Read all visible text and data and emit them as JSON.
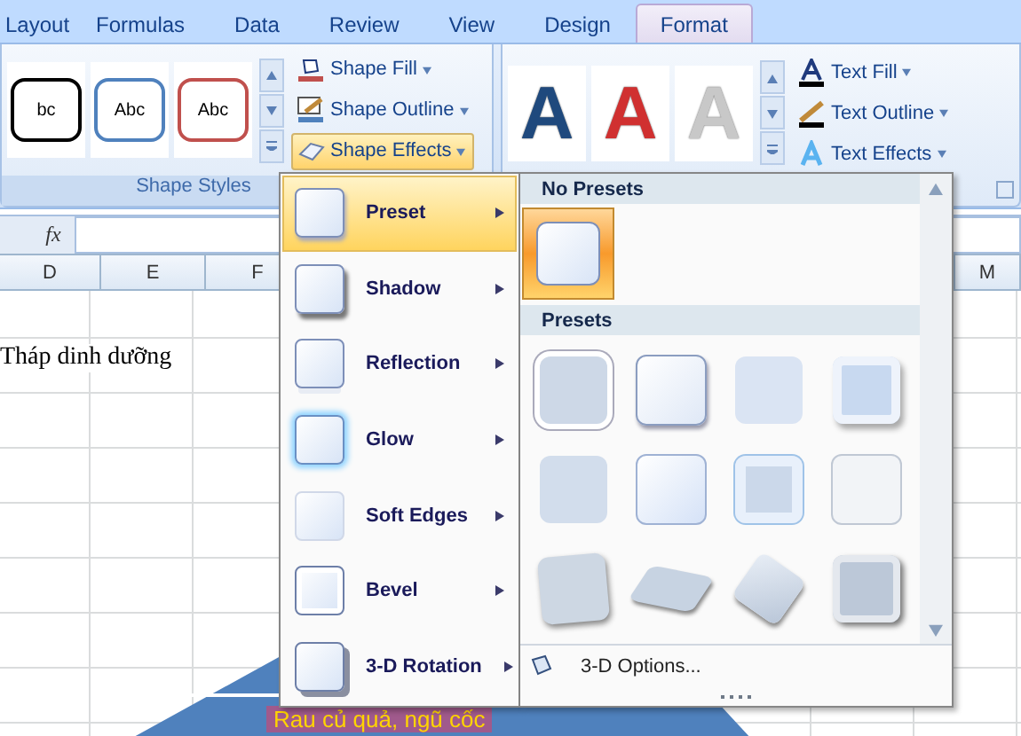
{
  "tabs": [
    {
      "label": "Layout",
      "selected": false
    },
    {
      "label": "Formulas",
      "selected": false
    },
    {
      "label": "Data",
      "selected": false
    },
    {
      "label": "Review",
      "selected": false
    },
    {
      "label": "View",
      "selected": false
    },
    {
      "label": "Design",
      "selected": false
    },
    {
      "label": "Format",
      "selected": true
    }
  ],
  "shape_styles": {
    "label": "Shape Styles",
    "gallery": [
      {
        "text": "bc",
        "color": "#000000"
      },
      {
        "text": "Abc",
        "color": "#4f81bd"
      },
      {
        "text": "Abc",
        "color": "#c0504d"
      }
    ],
    "commands": [
      {
        "label": "Shape Fill",
        "kind": "fill",
        "highlighted": false
      },
      {
        "label": "Shape Outline",
        "kind": "outline",
        "highlighted": false
      },
      {
        "label": "Shape Effects",
        "kind": "effects",
        "highlighted": true
      }
    ]
  },
  "wordart": {
    "gallery": [
      {
        "text": "A",
        "color": "#1f497d"
      },
      {
        "text": "A",
        "color": "#d03030"
      },
      {
        "text": "A",
        "color": "#c8c8c8"
      }
    ],
    "commands": [
      {
        "label": "Text Fill",
        "kind": "fill"
      },
      {
        "label": "Text Outline",
        "kind": "outline"
      },
      {
        "label": "Text Effects",
        "kind": "effects"
      }
    ]
  },
  "formula_bar": {
    "fx": "fx"
  },
  "columns": [
    {
      "label": "D"
    },
    {
      "label": "E"
    },
    {
      "label": "F"
    },
    {
      "label": "M"
    }
  ],
  "sheet": {
    "title": "Tháp dinh dưỡng",
    "bottom_text": "Rau củ quả, ngũ cốc"
  },
  "effects_menu": [
    {
      "label": "Preset",
      "kind": "preset",
      "selected": true
    },
    {
      "label": "Shadow",
      "kind": "shadow",
      "selected": false
    },
    {
      "label": "Reflection",
      "kind": "reflection",
      "selected": false
    },
    {
      "label": "Glow",
      "kind": "glow",
      "selected": false
    },
    {
      "label": "Soft Edges",
      "kind": "soft",
      "selected": false
    },
    {
      "label": "Bevel",
      "kind": "bevel",
      "selected": false
    },
    {
      "label": "3-D Rotation",
      "kind": "rotation",
      "selected": false
    }
  ],
  "preset_panel": {
    "none_header": "No Presets",
    "none_tile": {
      "selected": true
    },
    "presets_header": "Presets",
    "presets": [
      {
        "kind": "inset",
        "selected": false
      },
      {
        "kind": "raised",
        "selected": false
      },
      {
        "kind": "soft",
        "selected": false
      },
      {
        "kind": "pillow",
        "selected": false
      },
      {
        "kind": "flat",
        "selected": false
      },
      {
        "kind": "gloss",
        "selected": false
      },
      {
        "kind": "frame",
        "selected": false
      },
      {
        "kind": "plain",
        "selected": false
      },
      {
        "kind": "block",
        "selected": false
      },
      {
        "kind": "tilt",
        "selected": false
      },
      {
        "kind": "diamond",
        "selected": false
      },
      {
        "kind": "deep",
        "selected": false
      }
    ],
    "footer": "3-D Options..."
  }
}
